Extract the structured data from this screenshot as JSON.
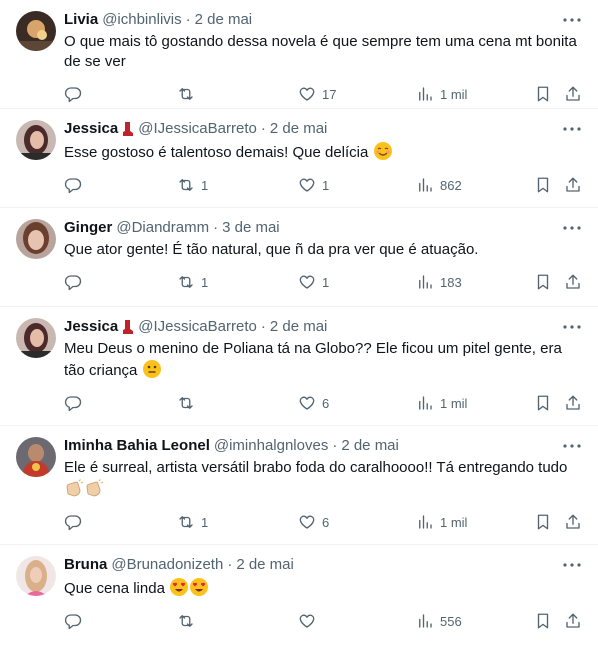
{
  "tweets": [
    {
      "name": "Livia",
      "handle": "@ichbinlivis",
      "date": "2 de mai",
      "text": "O que mais tô gostando dessa novela é que sempre tem uma cena mt bonita de se ver",
      "replies": "",
      "retweets": "",
      "likes": "17",
      "views": "1 mil"
    },
    {
      "name": "Jessica",
      "handle": "@IJessicaBarreto",
      "date": "2 de mai",
      "text": "Esse gostoso é talentoso demais! Que delícia",
      "emoji": "☺️",
      "replies": "",
      "retweets": "1",
      "likes": "1",
      "views": "862"
    },
    {
      "name": "Ginger",
      "handle": "@Diandramm",
      "date": "3 de mai",
      "text": "Que ator gente! É tão natural, que ñ da pra ver que é atuação.",
      "replies": "",
      "retweets": "1",
      "likes": "1",
      "views": "183"
    },
    {
      "name": "Jessica",
      "handle": "@IJessicaBarreto",
      "date": "2 de mai",
      "text": "Meu Deus o menino de Poliana tá na Globo?? Ele ficou um pitel gente, era tão criança",
      "emoji": "😐",
      "replies": "",
      "retweets": "",
      "likes": "6",
      "views": "1 mil"
    },
    {
      "name": "Iminha Bahia Leonel",
      "handle": "@iminhalgnloves",
      "date": "2 de mai",
      "text": "Ele é surreal, artista versátil brabo foda do caralhoooo!! Tá entregando tudo",
      "emoji": "👏🏼👏🏼",
      "replies": "",
      "retweets": "1",
      "likes": "6",
      "views": "1 mil"
    },
    {
      "name": "Bruna",
      "handle": "@Brunadonizeth",
      "date": "2 de mai",
      "text": "Que cena linda",
      "emoji": "😍😍",
      "replies": "",
      "retweets": "",
      "likes": "",
      "views": "556"
    }
  ],
  "colors": {
    "text": "#0f1419",
    "secondary": "#536471",
    "divider": "#eff3f4",
    "badge": "#c0242a"
  },
  "icons": [
    "reply-icon",
    "retweet-icon",
    "like-icon",
    "views-icon",
    "bookmark-icon",
    "share-icon",
    "more-icon"
  ]
}
